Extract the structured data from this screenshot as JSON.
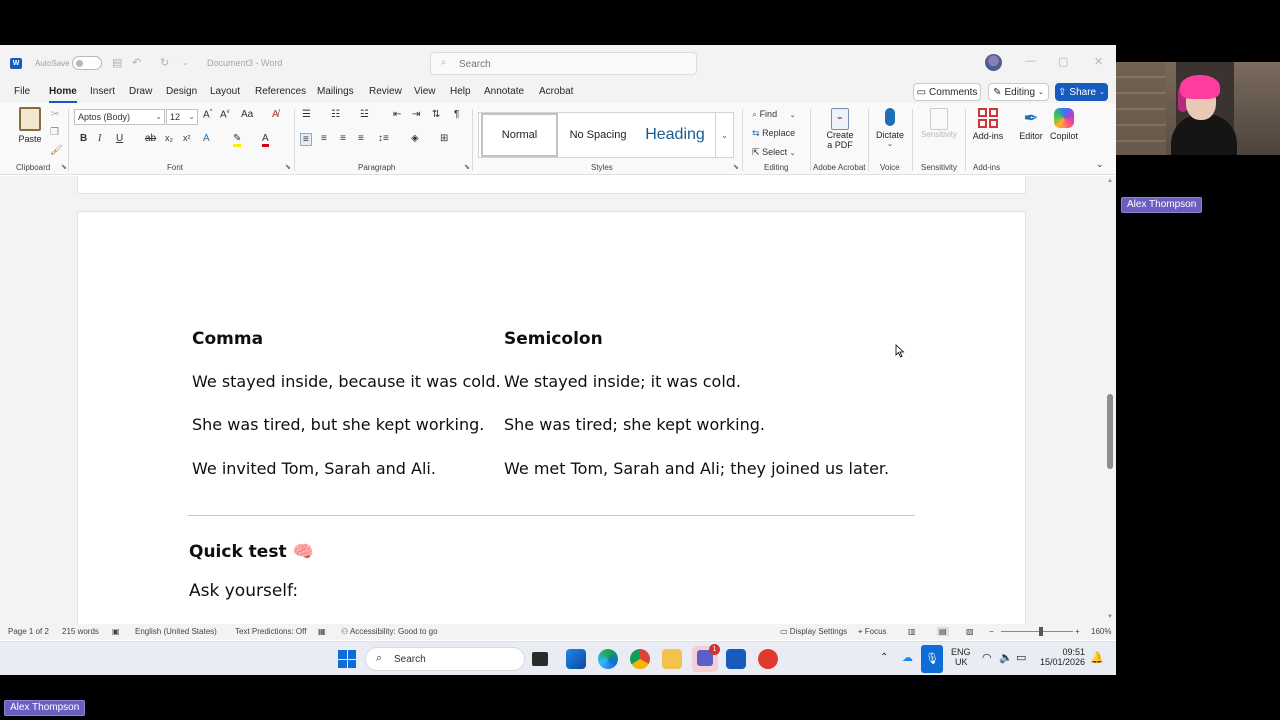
{
  "window": {
    "autosave_label": "AutoSave",
    "doc_title": "Document3 - Word",
    "search_placeholder": "Search"
  },
  "menu": {
    "tabs": [
      "File",
      "Home",
      "Insert",
      "Draw",
      "Design",
      "Layout",
      "References",
      "Mailings",
      "Review",
      "View",
      "Help",
      "Annotate",
      "Acrobat"
    ],
    "active_tab": "Home",
    "comments_label": "Comments",
    "editing_label": "Editing",
    "share_label": "Share"
  },
  "ribbon": {
    "paste_label": "Paste",
    "font_name": "Aptos (Body)",
    "font_size": "12",
    "styles": [
      "Normal",
      "No Spacing",
      "Heading"
    ],
    "find_label": "Find",
    "replace_label": "Replace",
    "select_label": "Select",
    "create_pdf_label_1": "Create",
    "create_pdf_label_2": "a PDF",
    "dictate_label": "Dictate",
    "sensitivity_label": "Sensitivity",
    "addins_label": "Add-ins",
    "editor_label": "Editor",
    "copilot_label": "Copilot",
    "groups": {
      "clipboard": "Clipboard",
      "font": "Font",
      "paragraph": "Paragraph",
      "styles": "Styles",
      "editing": "Editing",
      "adobe": "Adobe Acrobat",
      "voice": "Voice",
      "sensitivity": "Sensitivity",
      "addins": "Add-ins"
    }
  },
  "document": {
    "col1_heading": "Comma",
    "col2_heading": "Semicolon",
    "rows": [
      {
        "comma": "We stayed inside, because it was cold.",
        "semicolon": "We stayed inside; it was cold."
      },
      {
        "comma": "She was tired, but she kept working.",
        "semicolon": "She was tired; she kept working."
      },
      {
        "comma": "We invited Tom, Sarah and Ali.",
        "semicolon": "We met Tom, Sarah and Ali; they joined us later."
      }
    ],
    "quick_test_heading": "Quick test",
    "quick_test_emoji": "🧠",
    "ask_yourself": "Ask yourself:"
  },
  "status": {
    "page": "Page 1 of 2",
    "words": "215 words",
    "language": "English (United States)",
    "text_predictions": "Text Predictions: Off",
    "accessibility": "Accessibility: Good to go",
    "display_settings": "Display Settings",
    "focus": "Focus",
    "zoom": "160%"
  },
  "taskbar": {
    "search_label": "Search",
    "lang_1": "ENG",
    "lang_2": "UK",
    "time": "09:51",
    "date": "15/01/2026",
    "notification_badge": "1"
  },
  "call": {
    "participant_name": "Alex Thompson",
    "presenter_name": "Alex Thompson"
  },
  "colors": {
    "accent": "#185abd",
    "name_tag": "#6a5fc0",
    "hair": "#ff3ca0"
  }
}
